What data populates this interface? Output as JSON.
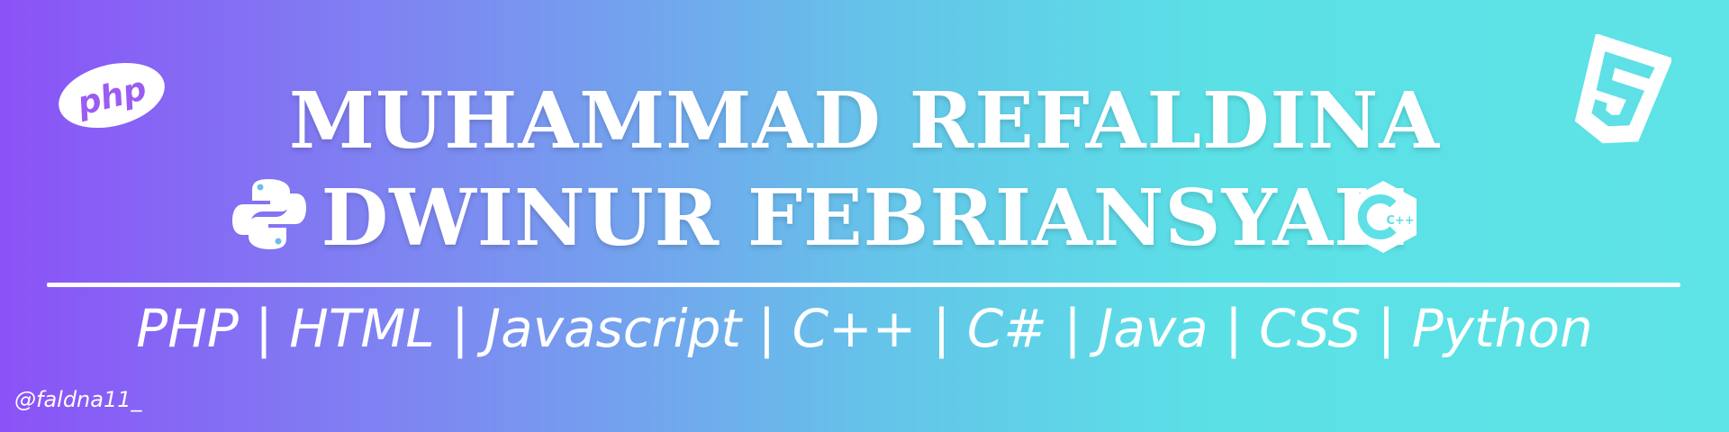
{
  "banner": {
    "name_line_1": "MUHAMMAD REFALDINA",
    "name_line_2": "DWINUR FEBRIANSYAH",
    "languages": "PHP | HTML | Javascript | C++ | C# | Java | CSS | Python",
    "handle": "@faldna11_",
    "php_logo_text": "php",
    "cpp_logo_text": "C++"
  },
  "icons": {
    "php": "php-icon",
    "python": "python-icon",
    "cpp": "cpp-icon",
    "html5": "html5-icon"
  },
  "colors": {
    "gradient_start": "#8b52f7",
    "gradient_end": "#5ee3e6",
    "text": "#ffffff"
  }
}
